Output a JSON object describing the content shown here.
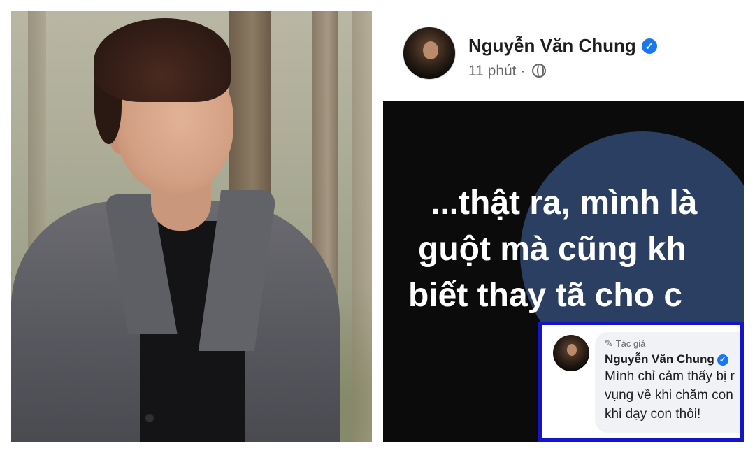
{
  "post": {
    "author": "Nguyễn Văn Chung",
    "time": "11 phút",
    "separator": "·",
    "privacy_icon": "globe-icon",
    "verified_icon": "verified-badge-icon",
    "image_text_lines": [
      "...thật ra, mình là",
      "guột mà cũng kh",
      "biết thay tã cho c"
    ]
  },
  "comment": {
    "badge": "Tác giả",
    "badge_icon": "pencil-icon",
    "author": "Nguyễn Văn Chung",
    "lines": [
      "Mình chỉ cảm thấy bị r",
      "vụng về khi chăm con",
      "khi dạy con thôi!"
    ]
  },
  "colors": {
    "verified": "#1877f2",
    "highlight_border": "#1414c8",
    "media_background": "#0b0b0b",
    "media_circle": "#2b3f63"
  }
}
